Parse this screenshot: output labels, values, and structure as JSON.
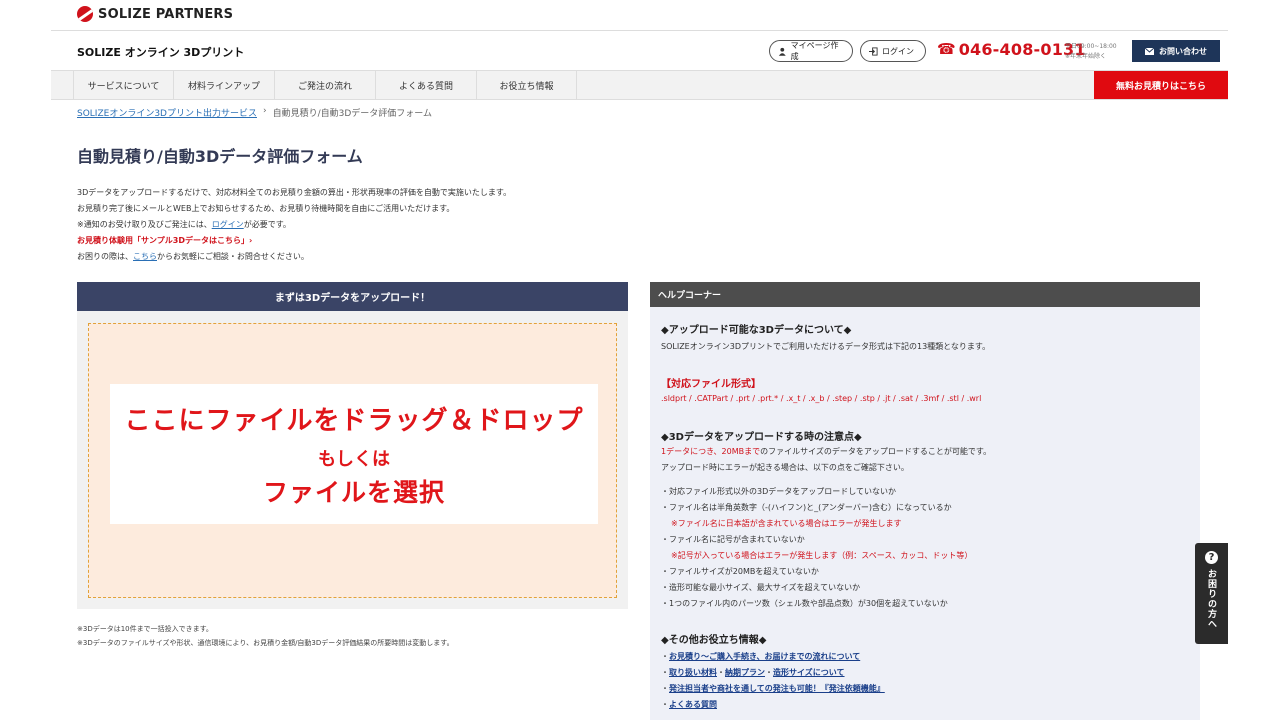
{
  "brand": {
    "name": "SOLIZE PARTNERS"
  },
  "header": {
    "site_title": "SOLIZE オンライン 3Dプリント",
    "mypage_label": "マイページ作成",
    "login_label": "ログイン",
    "phone": "046-408-0131",
    "hours_line1": "平日09:00~18:00",
    "hours_line2": "※年末年始除く",
    "contact_label": "お問い合わせ"
  },
  "nav": {
    "items": [
      {
        "label": "サービスについて"
      },
      {
        "label": "材料ラインアップ"
      },
      {
        "label": "ご発注の流れ"
      },
      {
        "label": "よくある質問"
      },
      {
        "label": "お役立ち情報"
      }
    ],
    "quote_label": "無料お見積りはこちら"
  },
  "breadcrumb": {
    "home": "SOLIZEオンライン3Dプリント出力サービス",
    "separator": "›",
    "current": "自動見積り/自動3Dデータ評価フォーム"
  },
  "page_title": "自動見積り/自動3Dデータ評価フォーム",
  "intro": {
    "line1": "3Dデータをアップロードするだけで、対応材料全てのお見積り金額の算出・形状再現率の評価を自動で実施いたします。",
    "line2": "お見積り完了後にメールとWEB上でお知らせするため、お見積り待機時間を自由にご活用いただけます。",
    "line3_pre": "※通知のお受け取り及びご発注には、",
    "line3_link": "ログイン",
    "line3_post": "が必要です。",
    "line4": "お見積り体験用「サンプル3Dデータはこちら」›",
    "line5_pre": "お困りの際は、",
    "line5_link": "こちら",
    "line5_post": "からお気軽にご相談・お問合せください。"
  },
  "upload": {
    "header": "まずは3Dデータをアップロード！",
    "drop_main": "ここにファイルをドラッグ＆ドロップ",
    "drop_or": "もしくは",
    "drop_select": "ファイルを選択",
    "note1": "※3Dデータは10件まで一括投入できます。",
    "note2": "※3Dデータのファイルサイズや形状、通信環境により、お見積り金額/自動3Dデータ評価結果の所要時間は変動します。"
  },
  "help": {
    "header": "ヘルプコーナー",
    "s1_title": "◆アップロード可能な3Dデータについて◆",
    "s1_text": "SOLIZEオンライン3Dプリントでご利用いただけるデータ形式は下記の13種類となります。",
    "formats_title": "【対応ファイル形式】",
    "formats": ".sldprt / .CATPart / .prt / .prt.* / .x_t / .x_b / .step / .stp / .jt / .sat / .3mf / .stl / .wrl",
    "s2_title": "◆3Dデータをアップロードする時の注意点◆",
    "s2_line1_red": "1データにつき、20MBまで",
    "s2_line1_post": "のファイルサイズのデータをアップロードすることが可能です。",
    "s2_line2": "アップロード時にエラーが起きる場合は、以下の点をご確認下さい。",
    "checks": [
      "・対応ファイル形式以外の3Dデータをアップロードしていないか",
      "・ファイル名は半角英数字（-(ハイフン)と_(アンダーバー)含む）になっているか",
      "※ファイル名に日本語が含まれている場合はエラーが発生します",
      "・ファイル名に記号が含まれていないか",
      "※記号が入っている場合はエラーが発生します（例：スペース、カッコ、ドット等）",
      "・ファイルサイズが20MBを超えていないか",
      "・造形可能な最小サイズ、最大サイズを超えていないか",
      "・1つのファイル内のパーツ数（シェル数や部品点数）が30個を超えていないか"
    ],
    "s3_title": "◆その他お役立ち情報◆",
    "links": [
      "お見積り〜ご購入手続き、お届けまでの流れについて",
      "取り扱い材料",
      "納期プラン",
      "造形サイズについて",
      "発注担当者や商社を通しての発注も可能！『発注依頼機能』",
      "よくある質問"
    ]
  },
  "side_tab": {
    "label": "お困りの方へ",
    "icon": "?"
  }
}
